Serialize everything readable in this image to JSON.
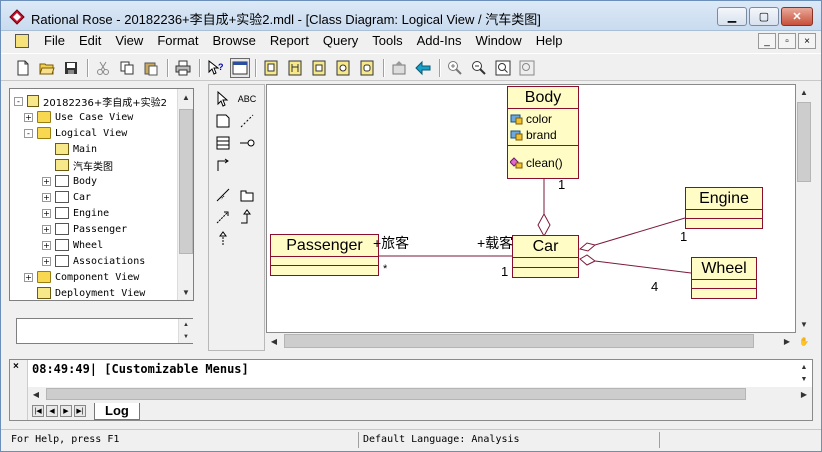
{
  "window": {
    "title": "Rational Rose - 20182236+李自成+实验2.mdl - [Class Diagram: Logical View / 汽车类图]",
    "minimize_label": "▁",
    "maximize_label": "▢",
    "close_label": "✕"
  },
  "menu": [
    "File",
    "Edit",
    "View",
    "Format",
    "Browse",
    "Report",
    "Query",
    "Tools",
    "Add-Ins",
    "Window",
    "Help"
  ],
  "mdi_controls": [
    "_",
    "▫",
    "×"
  ],
  "toolbar_icons": [
    "new-icon",
    "open-icon",
    "save-icon",
    "cut-icon",
    "copy-icon",
    "paste-icon",
    "print-icon",
    "context-help-icon",
    "view-documentation-icon",
    "browse-class-diagram-icon",
    "browse-interaction-diagram-icon",
    "browse-component-diagram-icon",
    "browse-deployment-diagram-icon",
    "browse-parent-icon",
    "browse-previous-icon",
    "zoom-in-icon",
    "zoom-out-icon",
    "fit-in-window-icon",
    "undo-fit-icon"
  ],
  "tree": {
    "root": "20182236+李自成+实验2",
    "items": [
      {
        "label": "Use Case View",
        "type": "folder",
        "level": 1,
        "expander": "+"
      },
      {
        "label": "Logical View",
        "type": "folder",
        "level": 1,
        "expander": "-"
      },
      {
        "label": "Main",
        "type": "diagram",
        "level": 2,
        "expander": ""
      },
      {
        "label": "汽车类图",
        "type": "diagram",
        "level": 2,
        "expander": ""
      },
      {
        "label": "Body",
        "type": "class",
        "level": 2,
        "expander": "+"
      },
      {
        "label": "Car",
        "type": "class",
        "level": 2,
        "expander": "+"
      },
      {
        "label": "Engine",
        "type": "class",
        "level": 2,
        "expander": "+"
      },
      {
        "label": "Passenger",
        "type": "class",
        "level": 2,
        "expander": "+"
      },
      {
        "label": "Wheel",
        "type": "class",
        "level": 2,
        "expander": "+"
      },
      {
        "label": "Associations",
        "type": "assoc",
        "level": 2,
        "expander": "+"
      },
      {
        "label": "Component View",
        "type": "folder",
        "level": 1,
        "expander": "+"
      },
      {
        "label": "Deployment View",
        "type": "deploy",
        "level": 1,
        "expander": ""
      }
    ]
  },
  "toolbox": {
    "text_tool_label": "ABC"
  },
  "diagram": {
    "classes": {
      "body": {
        "name": "Body",
        "attributes": [
          "color",
          "brand"
        ],
        "operations": [
          "clean()"
        ]
      },
      "car": {
        "name": "Car"
      },
      "engine": {
        "name": "Engine"
      },
      "passenger": {
        "name": "Passenger"
      },
      "wheel": {
        "name": "Wheel"
      }
    },
    "labels": {
      "body_car_mult": "1",
      "engine_mult": "1",
      "wheel_mult": "4",
      "passenger_role": "+旅客",
      "passenger_mult": "*",
      "car_role": "+载客",
      "car_mult": "1"
    }
  },
  "log": {
    "entry": "08:49:49|  [Customizable Menus]",
    "tab": "Log"
  },
  "status": {
    "help": "For Help, press F1",
    "language": "Default Language: Analysis"
  },
  "colors": {
    "class_fill": "#fffcc6",
    "class_border": "#8b0e2e",
    "association_line": "#7b1a3a"
  }
}
